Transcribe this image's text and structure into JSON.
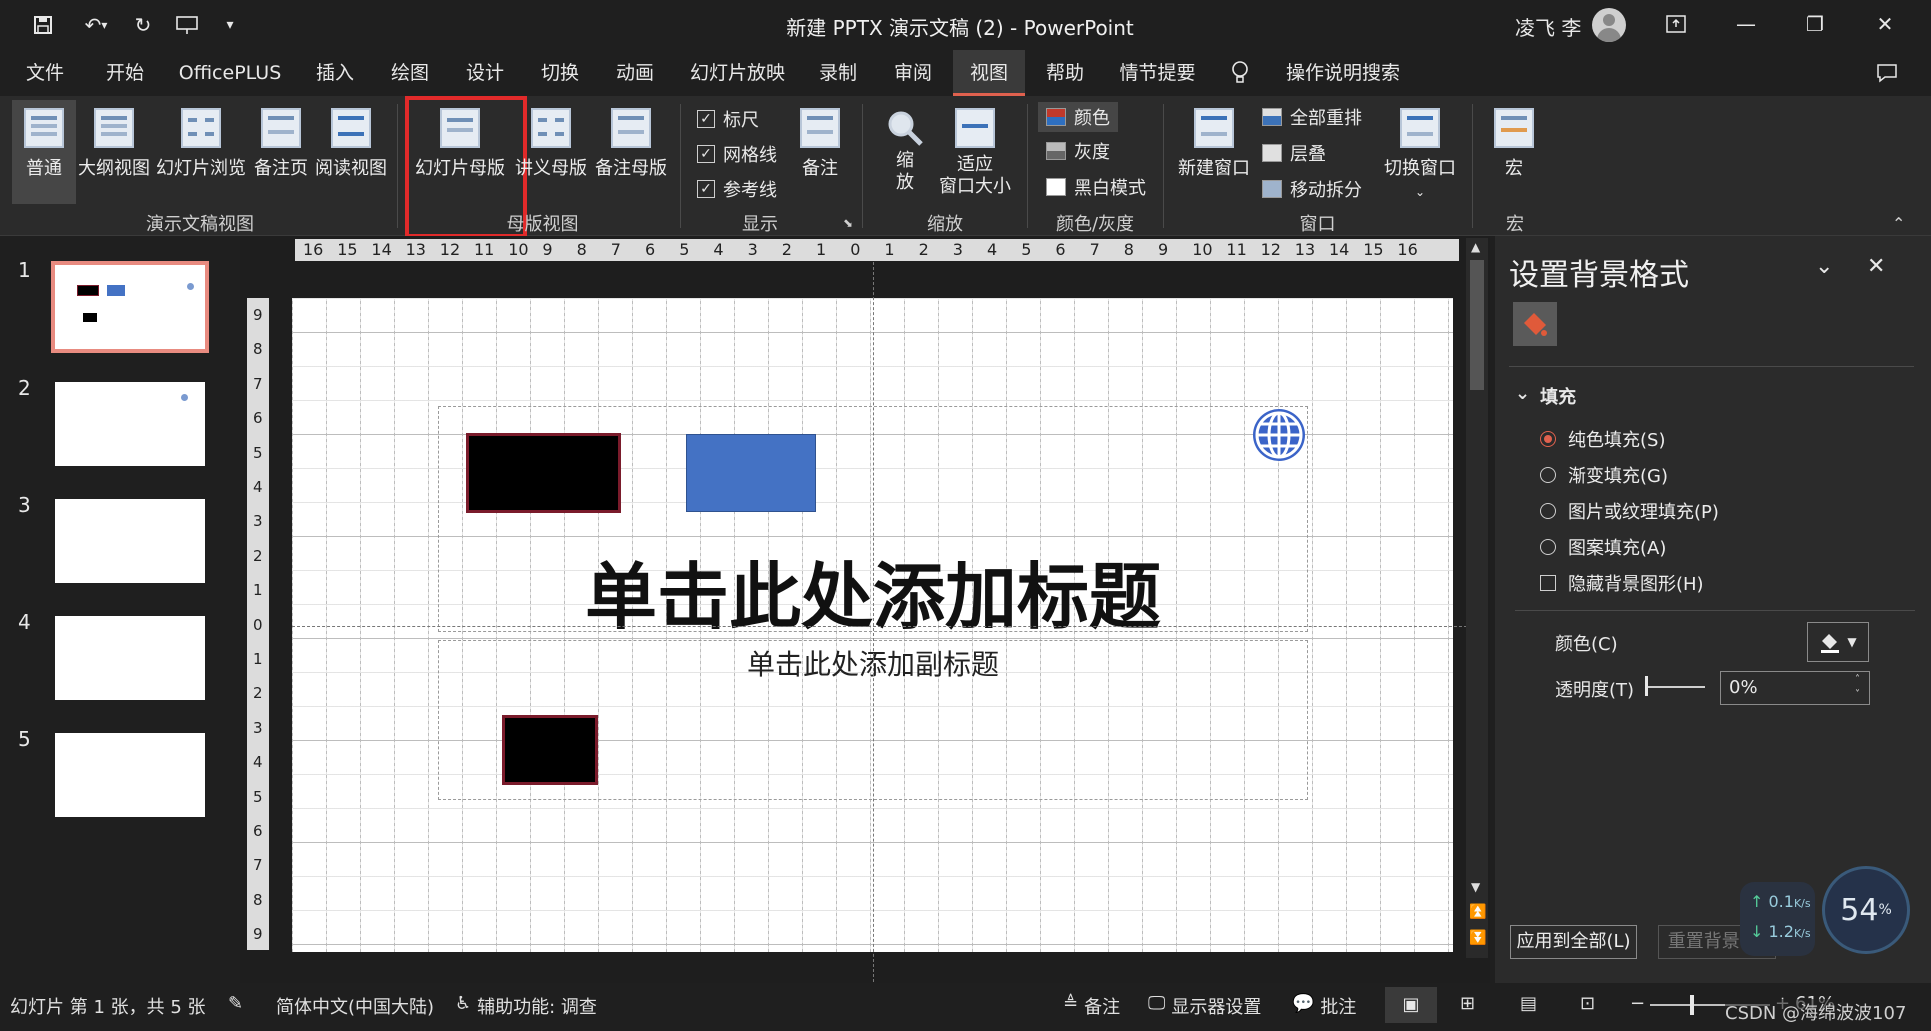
{
  "titlebar": {
    "title": "新建 PPTX 演示文稿 (2)  -  PowerPoint",
    "user": "凌飞 李"
  },
  "menu": {
    "tabs": [
      "文件",
      "开始",
      "OfficePLUS",
      "插入",
      "绘图",
      "设计",
      "切换",
      "动画",
      "幻灯片放映",
      "录制",
      "审阅",
      "视图",
      "帮助",
      "情节提要"
    ],
    "active": "视图",
    "search": "操作说明搜索"
  },
  "ribbon": {
    "groups": {
      "presentation_views": {
        "label": "演示文稿视图",
        "buttons": [
          "普通",
          "大纲视图",
          "幻灯片浏览",
          "备注页",
          "阅读视图"
        ]
      },
      "master_views": {
        "label": "母版视图",
        "buttons": [
          "幻灯片母版",
          "讲义母版",
          "备注母版"
        ]
      },
      "show": {
        "label": "显示",
        "checks": [
          "标尺",
          "网格线",
          "参考线"
        ],
        "notes": "备注"
      },
      "zoom": {
        "label": "缩放",
        "zoom_btn": "缩\n放",
        "fit_btn_line1": "适应",
        "fit_btn_line2": "窗口大小"
      },
      "color": {
        "label": "颜色/灰度",
        "items": [
          "颜色",
          "灰度",
          "黑白模式"
        ]
      },
      "window": {
        "label": "窗口",
        "new_window": "新建窗口",
        "items": [
          "全部重排",
          "层叠",
          "移动拆分"
        ],
        "switch": "切换窗口"
      },
      "macro": {
        "label": "宏",
        "button": "宏"
      }
    }
  },
  "ruler": {
    "h_ticks": [
      "16",
      "15",
      "14",
      "13",
      "12",
      "11",
      "10",
      "9",
      "8",
      "7",
      "6",
      "5",
      "4",
      "3",
      "2",
      "1",
      "0",
      "1",
      "2",
      "3",
      "4",
      "5",
      "6",
      "7",
      "8",
      "9",
      "10",
      "11",
      "12",
      "13",
      "14",
      "15",
      "16"
    ],
    "v_ticks": [
      "9",
      "8",
      "7",
      "6",
      "5",
      "4",
      "3",
      "2",
      "1",
      "0",
      "1",
      "2",
      "3",
      "4",
      "5",
      "6",
      "7",
      "8",
      "9"
    ]
  },
  "slides": {
    "numbers": [
      "1",
      "2",
      "3",
      "4",
      "5"
    ],
    "selected": 1
  },
  "slide": {
    "title_placeholder": "单击此处添加标题",
    "subtitle_placeholder": "单击此处添加副标题"
  },
  "format_pane": {
    "title": "设置背景格式",
    "section": "填充",
    "options": [
      "纯色填充(S)",
      "渐变填充(G)",
      "图片或纹理填充(P)",
      "图案填充(A)"
    ],
    "selected_option": "纯色填充(S)",
    "hide_bg": "隐藏背景图形(H)",
    "color_label": "颜色(C)",
    "transparency_label": "透明度(T)",
    "transparency_value": "0%",
    "apply_all": "应用到全部(L)",
    "reset": "重置背景(B)"
  },
  "net_widget": {
    "up": "0.1",
    "down": "1.2",
    "unit": "K/s",
    "percent": "54",
    "percent_sign": "%"
  },
  "statusbar": {
    "slide_info": "幻灯片 第 1 张，共 5 张",
    "language": "简体中文(中国大陆)",
    "accessibility": "辅助功能: 调查",
    "notes": "备注",
    "display": "显示器设置",
    "comments": "批注",
    "zoom": "61%",
    "watermark": "CSDN @海绵波波107"
  },
  "colors": {
    "accent_red": "#e0614e",
    "highlight_box": "#e12a2a",
    "blue_shape": "#4472c4",
    "dark_red_border": "#7a1b2b"
  }
}
